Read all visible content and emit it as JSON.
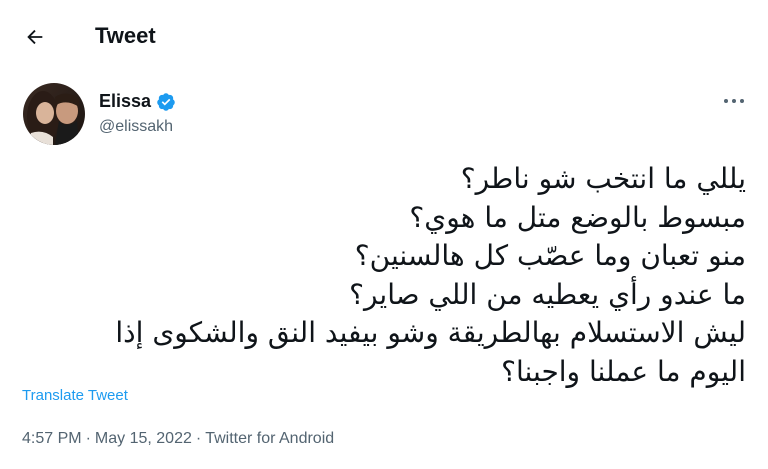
{
  "header": {
    "title": "Tweet"
  },
  "author": {
    "display_name": "Elissa",
    "handle": "@elissakh",
    "verified": true
  },
  "tweet": {
    "lines": [
      "يللي ما انتخب شو ناطر؟",
      "مبسوط بالوضع متل ما هوي؟",
      "منو تعبان وما عصّب كل هالسنين؟",
      "ما عندو رأي يعطيه من اللي صاير؟",
      "ليش الاستسلام بهالطريقة وشو بيفيد النق والشكوى إذا",
      "اليوم ما عملنا واجبنا؟"
    ],
    "translate_label": "Translate Tweet"
  },
  "meta": {
    "time": "4:57 PM",
    "separator": "·",
    "date": "May 15, 2022",
    "source": "Twitter for Android"
  },
  "colors": {
    "accent": "#1d9bf0",
    "secondary_text": "#536471",
    "primary_text": "#0f1419"
  },
  "icons": {
    "back": "arrow-left-icon",
    "verified": "verified-badge-icon",
    "more": "more-horizontal-icon"
  }
}
